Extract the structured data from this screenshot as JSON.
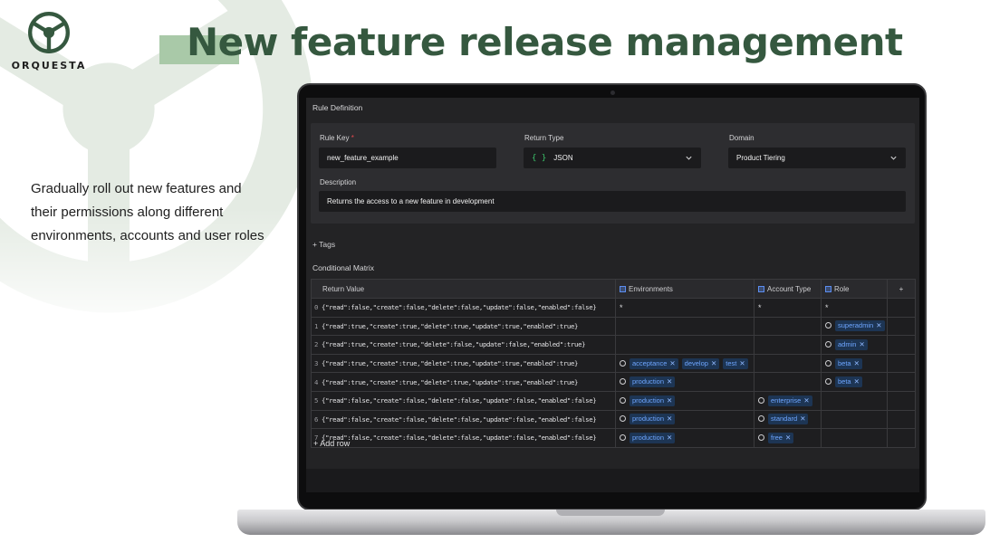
{
  "brand": {
    "name": "ORQUESTA"
  },
  "slide": {
    "title": "New feature release management",
    "tagline": "Gradually roll out new features and their permissions along different environments, accounts and user roles"
  },
  "app": {
    "rule_definition": {
      "heading": "Rule Definition",
      "rule_key": {
        "label": "Rule Key",
        "required_mark": "*",
        "value": "new_feature_example"
      },
      "return_type": {
        "label": "Return Type",
        "icon": "{ }",
        "value": "JSON"
      },
      "domain": {
        "label": "Domain",
        "value": "Product Tiering"
      },
      "description": {
        "label": "Description",
        "value": "Returns the access to a new feature in development"
      }
    },
    "tags_label": "+ Tags",
    "conditional_matrix": {
      "heading": "Conditional Matrix",
      "columns": {
        "return_value": "Return Value",
        "environments": "Environments",
        "account_type": "Account Type",
        "role": "Role",
        "add": "+"
      },
      "rows": [
        {
          "idx": "0",
          "value": "{\"read\":false,\"create\":false,\"delete\":false,\"update\":false,\"enabled\":false}",
          "env": "*",
          "acct": "*",
          "role": "*"
        },
        {
          "idx": "1",
          "value": "{\"read\":true,\"create\":true,\"delete\":true,\"update\":true,\"enabled\":true}",
          "roles": [
            "superadmin"
          ]
        },
        {
          "idx": "2",
          "value": "{\"read\":true,\"create\":true,\"delete\":false,\"update\":false,\"enabled\":true}",
          "roles": [
            "admin"
          ]
        },
        {
          "idx": "3",
          "value": "{\"read\":true,\"create\":true,\"delete\":true,\"update\":true,\"enabled\":true}",
          "envs": [
            "acceptance",
            "develop",
            "test"
          ],
          "roles": [
            "beta"
          ]
        },
        {
          "idx": "4",
          "value": "{\"read\":true,\"create\":true,\"delete\":true,\"update\":true,\"enabled\":true}",
          "envs": [
            "production"
          ],
          "roles": [
            "beta"
          ]
        },
        {
          "idx": "5",
          "value": "{\"read\":false,\"create\":false,\"delete\":false,\"update\":false,\"enabled\":false}",
          "envs": [
            "production"
          ],
          "accts": [
            "enterprise"
          ]
        },
        {
          "idx": "6",
          "value": "{\"read\":false,\"create\":false,\"delete\":false,\"update\":false,\"enabled\":false}",
          "envs": [
            "production"
          ],
          "accts": [
            "standard"
          ]
        },
        {
          "idx": "7",
          "value": "{\"read\":false,\"create\":false,\"delete\":false,\"update\":false,\"enabled\":false}",
          "envs": [
            "production"
          ],
          "accts": [
            "free"
          ]
        }
      ],
      "add_row_label": "+ Add row"
    }
  },
  "colors": {
    "title_green": "#35583f",
    "highlight": "#a9c9a8",
    "chip_text": "#6ea6ff",
    "chip_bg": "#1d3554",
    "json_green": "#3cc36a"
  },
  "icons": {
    "logo": "steering-wheel-icon",
    "dropdown": "chevron-down-icon",
    "column": "column-type-icon",
    "chip_remove": "close-icon",
    "condition": "circle-icon"
  }
}
